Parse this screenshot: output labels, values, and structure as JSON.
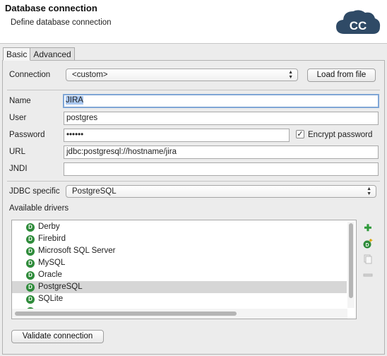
{
  "header": {
    "title": "Database connection",
    "subtitle": "Define database connection",
    "logo_text": "CC",
    "logo_color": "#2f4a66"
  },
  "tabs": [
    {
      "label": "Basic",
      "active": true
    },
    {
      "label": "Advanced",
      "active": false
    }
  ],
  "form": {
    "connection_label": "Connection",
    "connection_value": "<custom>",
    "load_button": "Load from file",
    "name_label": "Name",
    "name_value": "JIRA",
    "user_label": "User",
    "user_value": "postgres",
    "password_label": "Password",
    "password_value": "••••••",
    "encrypt_label": "Encrypt password",
    "encrypt_checked": true,
    "url_label": "URL",
    "url_value": "jdbc:postgresql://hostname/jira",
    "jndi_label": "JNDI",
    "jndi_value": "",
    "jdbc_label": "JDBC specific",
    "jdbc_value": "PostgreSQL"
  },
  "drivers": {
    "label": "Available drivers",
    "items": [
      "Derby",
      "Firebird",
      "Microsoft SQL Server",
      "MySQL",
      "Oracle",
      "PostgreSQL",
      "SQLite"
    ],
    "selected": "PostgreSQL",
    "icon_letter": "D"
  },
  "footer": {
    "validate_button": "Validate connection"
  }
}
